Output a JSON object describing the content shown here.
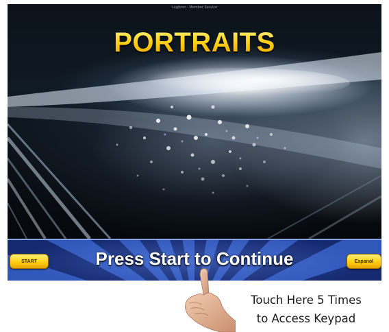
{
  "screen": {
    "header_caption": "Logitron - Member Service",
    "title": "PORTRAITS",
    "banner_text": "Press Start to Continue",
    "start_label": "START",
    "espanol_label": "Espanol"
  },
  "instruction": {
    "line1": "Touch Here 5 Times",
    "line2": "to Access Keypad"
  },
  "colors": {
    "title_gold": "#ffd21a",
    "button_gold": "#ffcf10",
    "banner_blue": "#1d3a8f"
  },
  "icons": {
    "pointer": "pointing-hand-icon"
  }
}
